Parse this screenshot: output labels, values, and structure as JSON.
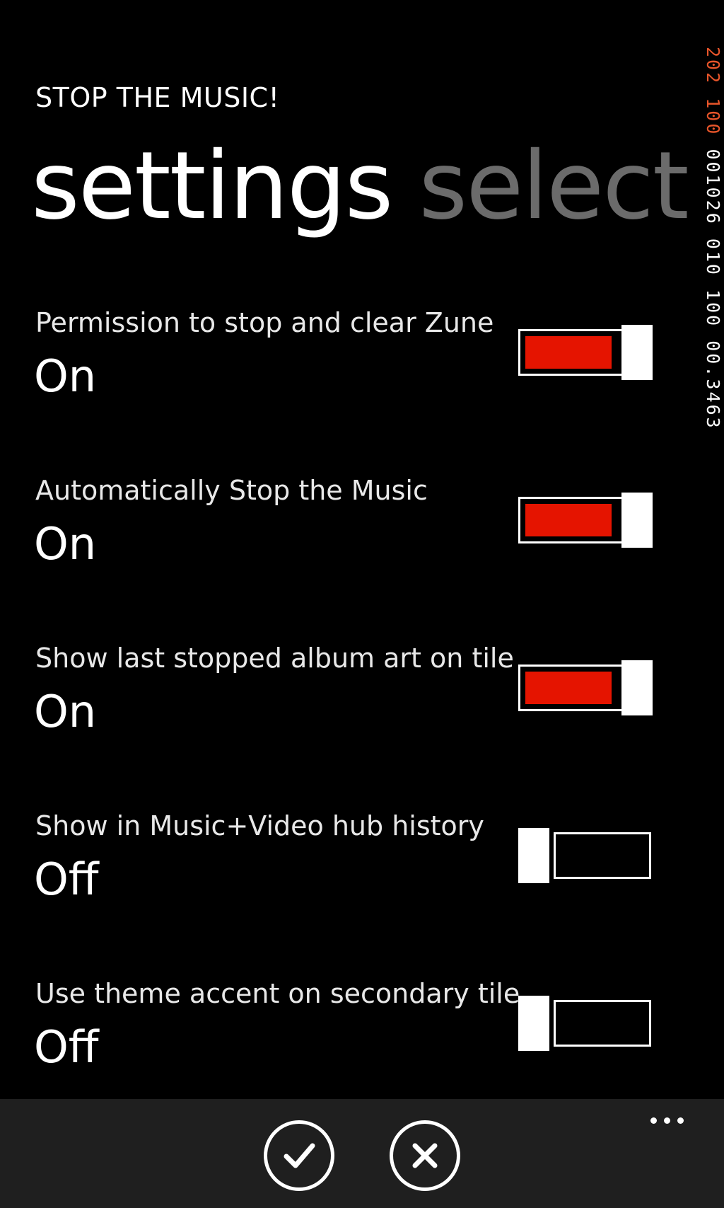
{
  "app": {
    "title": "STOP THE MUSIC!"
  },
  "pivot": {
    "items": [
      {
        "label": "settings",
        "active": true
      },
      {
        "label": "select",
        "active": false
      }
    ]
  },
  "debug": {
    "counters": [
      {
        "text": "202",
        "color": "#e8552a"
      },
      {
        "text": "100",
        "color": "#e8552a"
      },
      {
        "text": "001026",
        "color": "#ffffff"
      },
      {
        "text": "010",
        "color": "#ffffff"
      },
      {
        "text": "100",
        "color": "#ffffff"
      },
      {
        "text": "00.3463",
        "color": "#ffffff"
      }
    ]
  },
  "settings": {
    "items": [
      {
        "label": "Permission to stop and clear Zune",
        "state": "On",
        "enabled": true
      },
      {
        "label": "Automatically Stop the Music",
        "state": "On",
        "enabled": true
      },
      {
        "label": "Show last stopped album art on tile",
        "state": "On",
        "enabled": true
      },
      {
        "label": "Show in Music+Video hub history",
        "state": "Off",
        "enabled": false
      },
      {
        "label": "Use theme accent on secondary tile",
        "state": "Off",
        "enabled": false
      }
    ]
  },
  "app_bar": {
    "buttons": [
      {
        "icon": "check-icon"
      },
      {
        "icon": "close-icon"
      }
    ],
    "more_icon": "more-dots-icon"
  },
  "colors": {
    "accent": "#e51400",
    "background": "#000000",
    "app_bar": "#1f1f1f",
    "inactive_header": "#6b6b6b",
    "debug_orange": "#e8552a"
  }
}
